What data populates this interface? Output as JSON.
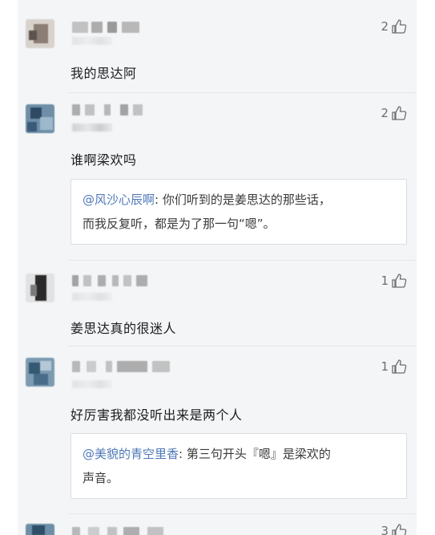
{
  "comments": [
    {
      "text": "我的思达阿",
      "likes": "2"
    },
    {
      "text": "谁啊梁欢吗",
      "likes": "2",
      "reply": {
        "mention": "@风沙心辰啊",
        "body": ": 你们听到的是姜思达的那些话，",
        "body2": "而我反复听，都是为了那一句“嗯”。"
      }
    },
    {
      "text": "姜思达真的很迷人",
      "likes": "1"
    },
    {
      "text": "好厉害我都没听出来是两个人",
      "likes": "1",
      "reply": {
        "mention": "@美貌的青空里香",
        "body": ": 第三句开头『嗯』是梁欢的",
        "body2": "声音。"
      }
    },
    {
      "likes": "3"
    }
  ],
  "icons": {
    "like": "thumbs-up-icon"
  },
  "colors": {
    "background": "#f4f5f7",
    "mention": "#4f78b8",
    "text": "#1c1c1c"
  }
}
